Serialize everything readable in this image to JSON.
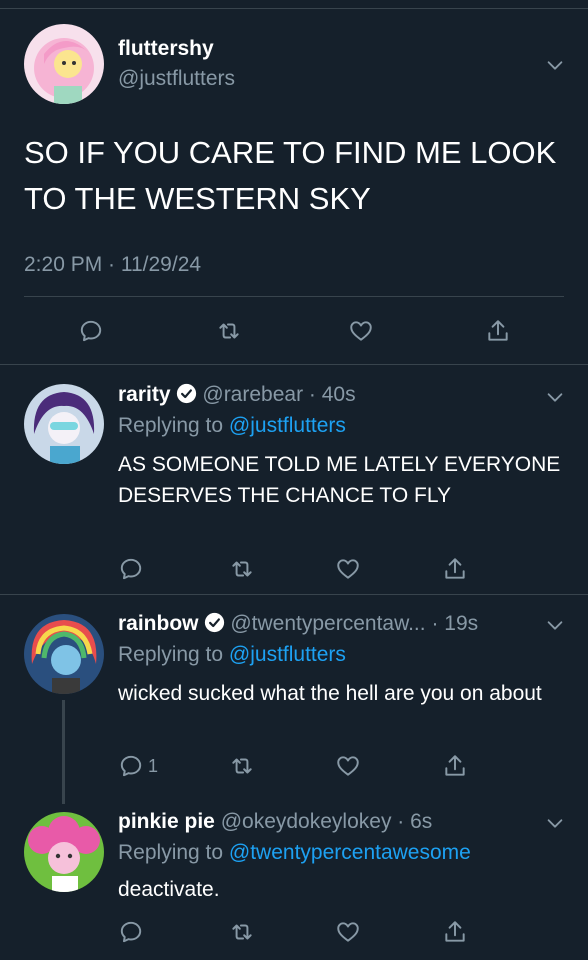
{
  "colors": {
    "background": "#15202b",
    "divider": "#38444d",
    "muted": "#8899a6",
    "link": "#1da1f2"
  },
  "main_tweet": {
    "display_name": "fluttershy",
    "handle": "@justflutters",
    "text": "SO IF YOU CARE TO FIND ME LOOK TO THE WESTERN SKY",
    "timestamp": "2:20 PM · 11/29/24"
  },
  "replies": [
    {
      "display_name": "rarity",
      "handle": "@rarebear",
      "time": "· 40s",
      "replying_prefix": "Replying to",
      "replying_to": "@justflutters",
      "text": "AS SOMEONE TOLD ME LATELY EVERYONE DESERVES THE CHANCE TO FLY"
    },
    {
      "display_name": "rainbow",
      "handle": "@twentypercentaw...",
      "time": "· 19s",
      "replying_prefix": "Replying to",
      "replying_to": "@justflutters",
      "text": "wicked sucked what the hell are you on about",
      "reply_count": "1"
    },
    {
      "display_name": "pinkie pie",
      "handle": "@okeydokeylokey",
      "time": "· 6s",
      "replying_prefix": "Replying to",
      "replying_to": "@twentypercentawesome",
      "text": "deactivate."
    }
  ]
}
